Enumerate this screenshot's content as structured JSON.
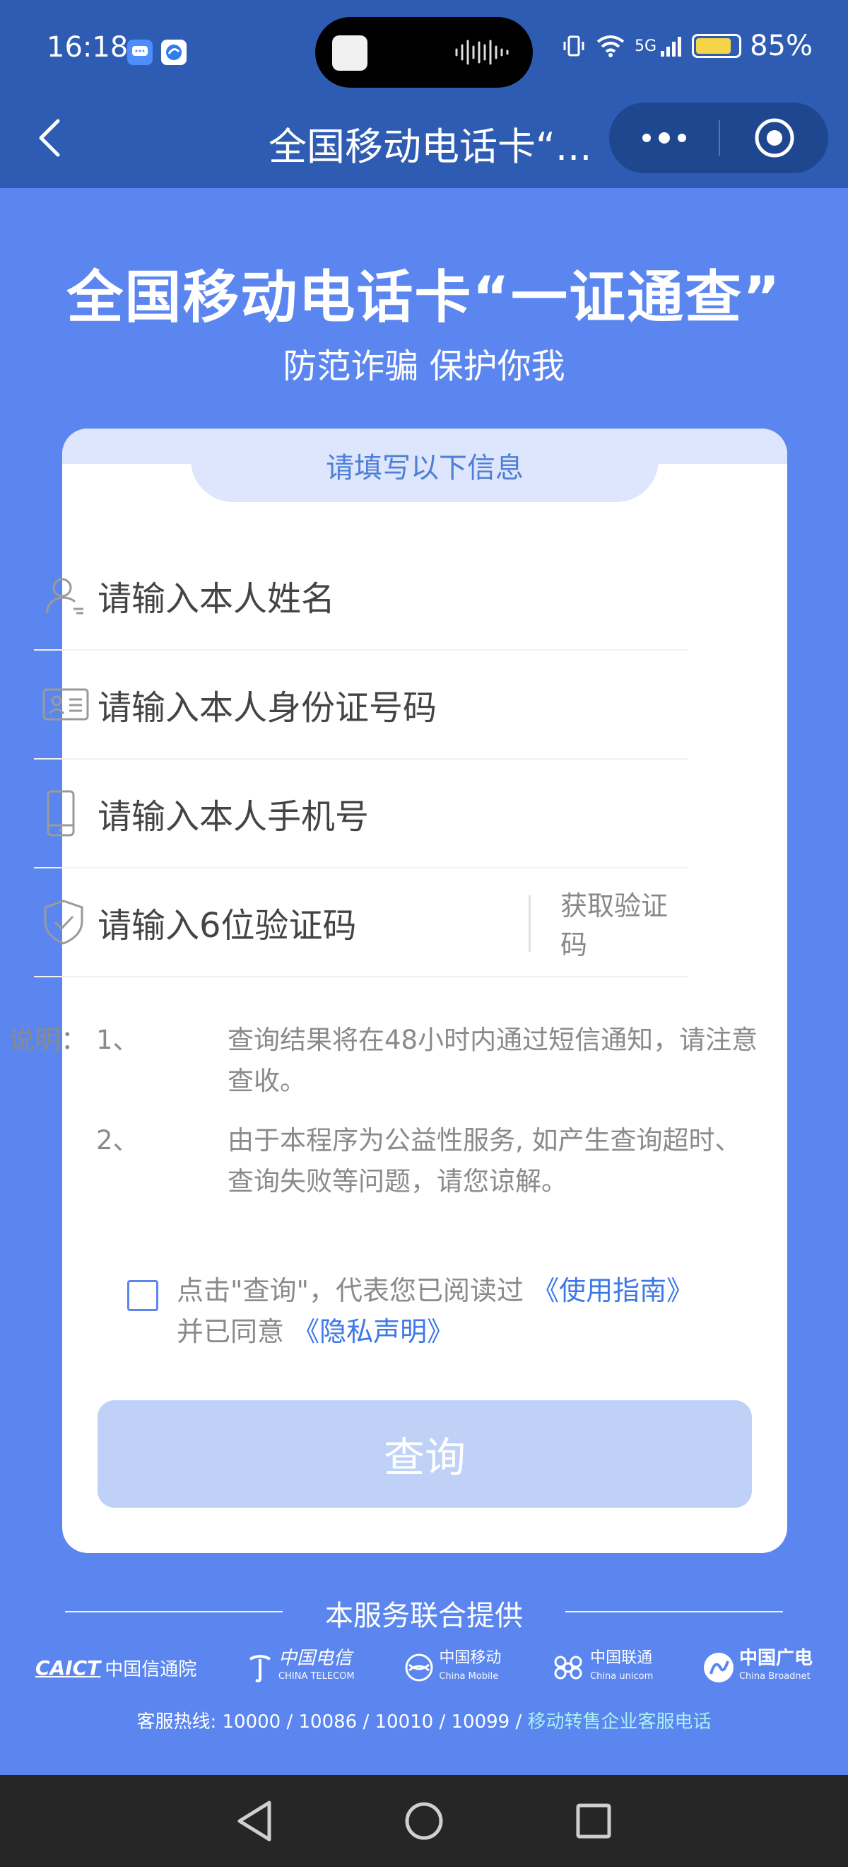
{
  "status_bar": {
    "time": "16:18",
    "network": "5G",
    "battery": "85%",
    "battery_level": 0.85
  },
  "titlebar": {
    "title": "全国移动电话卡“..."
  },
  "hero": {
    "title": "全国移动电话卡“一证通查”",
    "subtitle": "防范诈骗 保护你我"
  },
  "form": {
    "header": "请填写以下信息",
    "name_placeholder": "请输入本人姓名",
    "id_placeholder": "请输入本人身份证号码",
    "phone_placeholder": "请输入本人手机号",
    "code_placeholder": "请输入6位验证码",
    "get_code_label": "获取验证码"
  },
  "notes": {
    "label": "说明：",
    "items": [
      {
        "num": "1、",
        "text": "查询结果将在48小时内通过短信通知，请注意查收。"
      },
      {
        "num": "2、",
        "text": "由于本程序为公益性服务, 如产生查询超时、查询失败等问题，请您谅解。"
      }
    ]
  },
  "agreement": {
    "prefix": "点击\"查询\"，代表您已阅读过",
    "guide_link": "《使用指南》",
    "middle": "并已同意",
    "privacy_link": "《隐私声明》",
    "checked": false
  },
  "query_button": {
    "label": "查询"
  },
  "footer": {
    "provider_text": "本服务联合提供",
    "logos": [
      {
        "main": "CAICT",
        "cn": "中国信通院"
      },
      {
        "cn": "中国电信",
        "en": "CHINA TELECOM"
      },
      {
        "cn": "中国移动",
        "en": "China Mobile"
      },
      {
        "cn": "中国联通",
        "en": "China unicom"
      },
      {
        "cn": "中国广电",
        "en": "China Broadnet"
      }
    ],
    "hotline_prefix": "客服热线: 10000 / 10086 / 10010 / 10099 /",
    "hotline_link": "移动转售企业客服电话"
  },
  "colors": {
    "background": "#5b86f0",
    "topbar": "#2f5cb3",
    "accent": "#3d78e8",
    "button_disabled": "#c0d1f8"
  }
}
